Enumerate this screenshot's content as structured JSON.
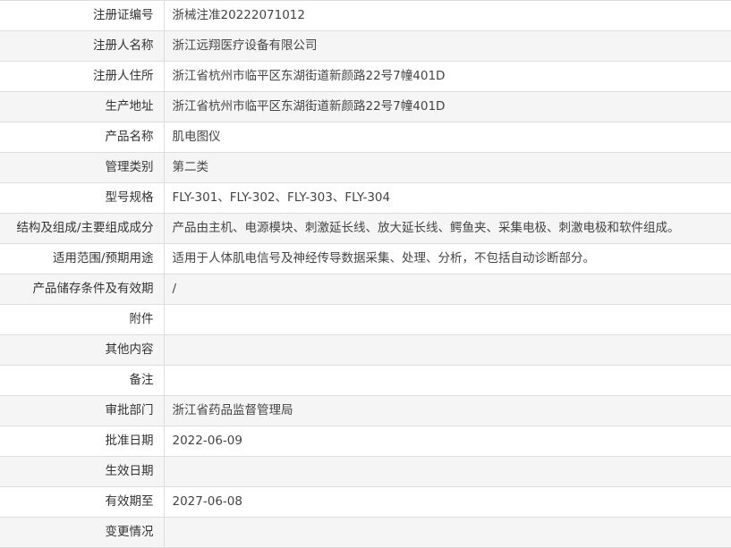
{
  "record": {
    "rows": [
      {
        "label": "注册证编号",
        "value": "浙械注准20222071012"
      },
      {
        "label": "注册人名称",
        "value": "浙江远翔医疗设备有限公司"
      },
      {
        "label": "注册人住所",
        "value": "浙江省杭州市临平区东湖街道新颜路22号7幢401D"
      },
      {
        "label": "生产地址",
        "value": "浙江省杭州市临平区东湖街道新颜路22号7幢401D"
      },
      {
        "label": "产品名称",
        "value": "肌电图仪"
      },
      {
        "label": "管理类别",
        "value": "第二类"
      },
      {
        "label": "型号规格",
        "value": "FLY-301、FLY-302、FLY-303、FLY-304"
      },
      {
        "label": "结构及组成/主要组成成分",
        "value": "产品由主机、电源模块、刺激延长线、放大延长线、鳄鱼夹、采集电极、刺激电极和软件组成。"
      },
      {
        "label": "适用范围/预期用途",
        "value": "适用于人体肌电信号及神经传导数据采集、处理、分析，不包括自动诊断部分。"
      },
      {
        "label": "产品储存条件及有效期",
        "value": "/"
      },
      {
        "label": "附件",
        "value": ""
      },
      {
        "label": "其他内容",
        "value": ""
      },
      {
        "label": "备注",
        "value": ""
      },
      {
        "label": "审批部门",
        "value": "浙江省药品监督管理局"
      },
      {
        "label": "批准日期",
        "value": "2022-06-09"
      },
      {
        "label": "生效日期",
        "value": ""
      },
      {
        "label": "有效期至",
        "value": "2027-06-08"
      },
      {
        "label": "变更情况",
        "value": ""
      }
    ]
  }
}
